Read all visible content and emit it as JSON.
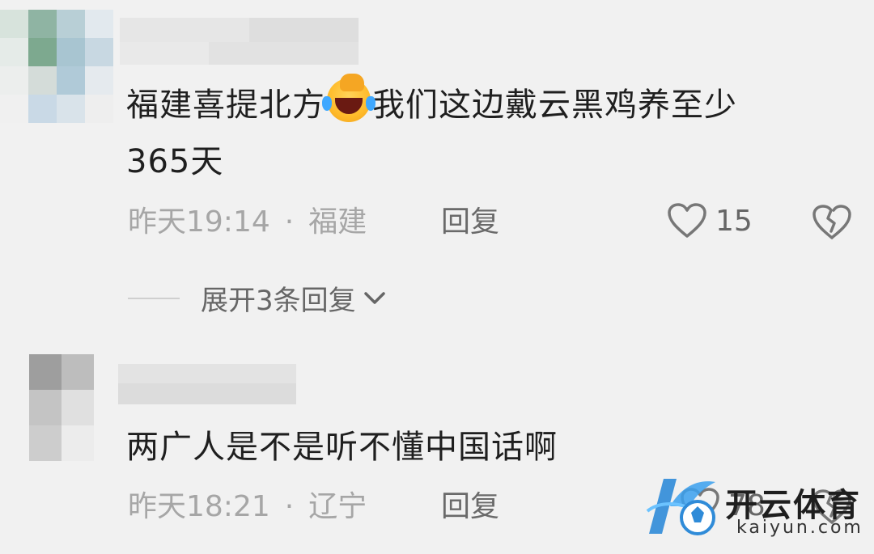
{
  "comments": [
    {
      "text_before_emoji": "福建喜提北方",
      "text_after_emoji": "我们这边戴云黑鸡养至少",
      "text_line2": "365天",
      "time": "昨天19:14",
      "location": "福建",
      "reply_label": "回复",
      "likes": "15",
      "expand_label": "展开3条回复"
    },
    {
      "text": "两广人是不是听不懂中国话啊",
      "time": "昨天18:21",
      "location": "辽宁",
      "reply_label": "回复",
      "likes": "78"
    }
  ],
  "separator": "·",
  "watermark": {
    "brand": "开云体育",
    "url": "kaiyun.com"
  },
  "colors": {
    "background": "#f1f1f1",
    "text": "#1f1f1f",
    "meta": "#a6a6a6",
    "accent_blue": "#2f8bd8"
  },
  "icons": {
    "emoji": "face-palm-laugh-emoji",
    "like": "heart-outline-icon",
    "dislike": "broken-heart-icon",
    "expand": "chevron-down-icon"
  }
}
